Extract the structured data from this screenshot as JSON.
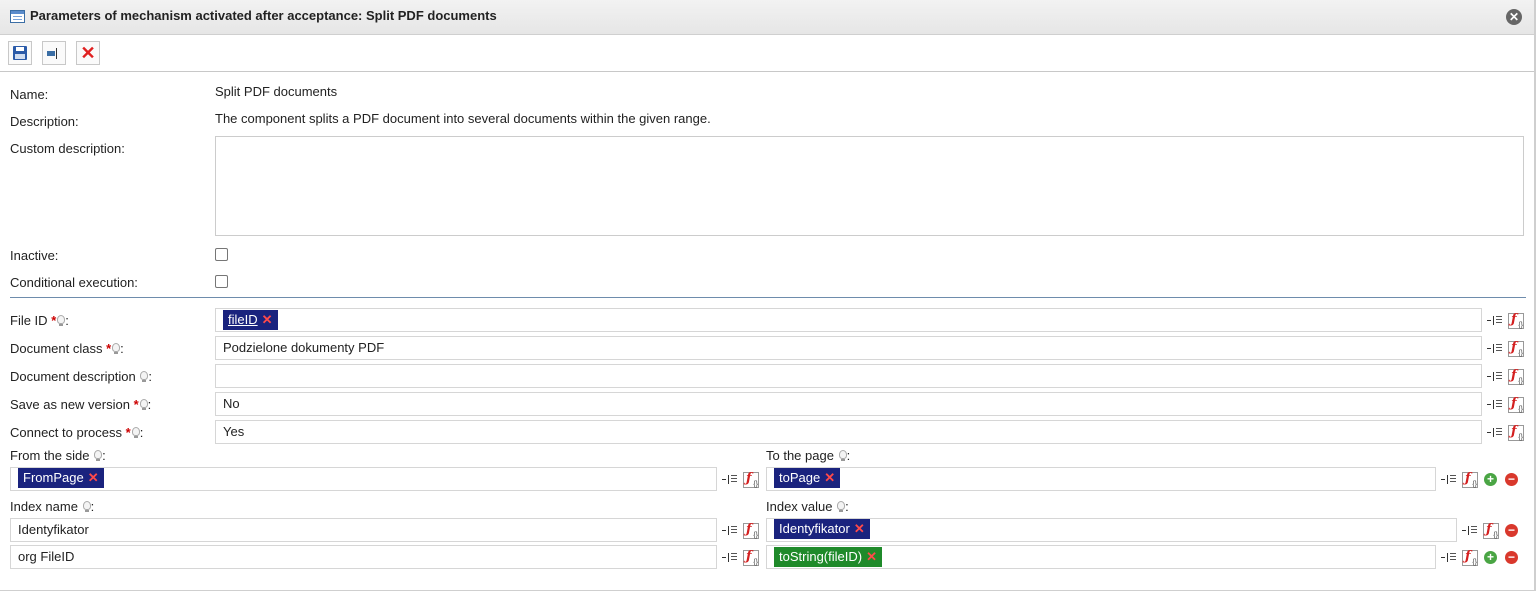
{
  "window": {
    "title": "Parameters of mechanism activated after acceptance: Split PDF documents"
  },
  "toolbar": {
    "save_icon": "save-icon",
    "field_icon": "form-field-icon",
    "delete_icon": "delete-icon"
  },
  "info": {
    "name_label": "Name:",
    "name_value": "Split PDF documents",
    "description_label": "Description:",
    "description_value": "The component splits a PDF document into several documents within the given range.",
    "custom_description_label": "Custom description:",
    "custom_description_value": "",
    "inactive_label": "Inactive:",
    "inactive_checked": false,
    "conditional_label": "Conditional execution:",
    "conditional_checked": false
  },
  "params": {
    "file_id": {
      "label": "File ID",
      "required": "*",
      "chip": "fileID"
    },
    "document_class": {
      "label": "Document class",
      "required": "*",
      "value": "Podzielone dokumenty PDF"
    },
    "document_description": {
      "label": "Document description",
      "value": ""
    },
    "save_as_new_version": {
      "label": "Save as new version",
      "required": "*",
      "value": "No"
    },
    "connect_to_process": {
      "label": "Connect to process",
      "required": "*",
      "value": "Yes"
    },
    "from_side": {
      "label": "From the side",
      "chip": "FromPage"
    },
    "to_page": {
      "label": "To the page",
      "chip": "toPage"
    },
    "index_name": {
      "label": "Index name",
      "rows": [
        "Identyfikator",
        "org FileID"
      ]
    },
    "index_value": {
      "label": "Index value",
      "rows": [
        "Identyfikator",
        "toString(fileID)"
      ]
    }
  },
  "common": {
    "colon": ":",
    "remove_mark": "✕",
    "add_mark": "+",
    "minus_mark": "−",
    "close_mark": "✕"
  },
  "colors": {
    "chip_blue": "#1a237e",
    "chip_green": "#1f8a2a",
    "required_red": "#cc0000"
  }
}
